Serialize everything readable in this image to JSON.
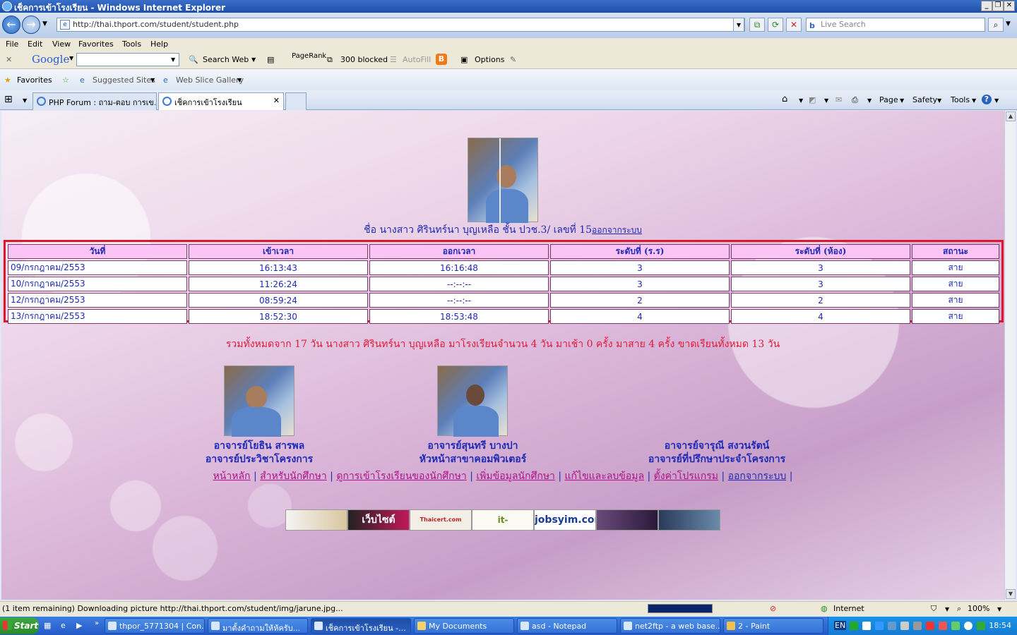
{
  "window": {
    "title": "เช็คการเข้าโรงเรียน - Windows Internet Explorer",
    "url": "http://thai.thport.com/student/student.php",
    "search_placeholder": "Live Search"
  },
  "menu": [
    "File",
    "Edit",
    "View",
    "Favorites",
    "Tools",
    "Help"
  ],
  "google_toolbar": {
    "logo": "Google",
    "search_web": "Search Web",
    "pagerank": "PageRank",
    "blocked": "300 blocked",
    "autofill": "AutoFill",
    "options": "Options"
  },
  "favorites_bar": {
    "favorites": "Favorites",
    "suggested": "Suggested Sites",
    "web_slice": "Web Slice Gallery"
  },
  "tabs": [
    {
      "label": "PHP Forum : ถาม-ตอบ การเข..."
    },
    {
      "label": "เช็คการเข้าโรงเรียน"
    }
  ],
  "command_bar": {
    "page": "Page",
    "safety": "Safety",
    "tools": "Tools"
  },
  "page": {
    "student_line": "ชื่อ นางสาว ศิรินทร์นา บุญเหลือ ชั้น ปวช.3/ เลขที่ 15",
    "logout_inline": "ออกจากระบบ",
    "table": {
      "headers": [
        "วันที่",
        "เข้าเวลา",
        "ออกเวลา",
        "ระดับที่ (ร.ร)",
        "ระดับที่ (ห้อง)",
        "สถานะ"
      ],
      "rows": [
        [
          "09/กรกฎาคม/2553",
          "16:13:43",
          "16:16:48",
          "3",
          "3",
          "สาย"
        ],
        [
          "10/กรกฎาคม/2553",
          "11:26:24",
          "--:--:--",
          "3",
          "3",
          "สาย"
        ],
        [
          "12/กรกฎาคม/2553",
          "08:59:24",
          "--:--:--",
          "2",
          "2",
          "สาย"
        ],
        [
          "13/กรกฎาคม/2553",
          "18:52:30",
          "18:53:48",
          "4",
          "4",
          "สาย"
        ]
      ]
    },
    "summary": "รวมทั้งหมดจาก 17 วัน นางสาว ศิรินทร์นา บุญเหลือ มาโรงเรียนจำนวน 4 วัน มาเช้า 0 ครั้ง มาสาย 4 ครั้ง ขาดเรียนทั้งหมด 13 วัน",
    "teachers": [
      {
        "name": "อาจารย์โยธิน สารพล",
        "role": "อาจารย์ประวิชาโครงการ"
      },
      {
        "name": "อาจารย์สุนทรี บางปา",
        "role": "หัวหน้าสาขาคอมพิวเตอร์"
      },
      {
        "name": "อาจารย์จารุณี สงวนรัตน์",
        "role": "อาจารย์ที่ปรึกษาประจำโครงการ"
      }
    ],
    "nav_links": [
      "หน้าหลัก",
      "สำหรับนักศึกษา",
      "ดูการเข้าโรงเรียนของนักศึกษา",
      "เพิ่มข้อมูลนักศึกษา",
      "แก้ไขและลบข้อมูล",
      "ตั้งค่าโปรแกรม",
      "ออกจากระบบ"
    ],
    "banners": [
      "",
      "เว็บไซต์",
      "Thaicert.com",
      "it-socool.com",
      "jobsyim.com",
      "",
      ""
    ]
  },
  "statusbar": {
    "text": "(1 item remaining) Downloading picture http://thai.thport.com/student/img/jarune.jpg...",
    "progress_fraction": 1.0,
    "zone": "Internet",
    "zoom": "100%"
  },
  "taskbar": {
    "start": "Start",
    "tasks": [
      "thpor_5771304 | Con...",
      "มาตั้งคำถามให้ห้ครับ...",
      "เช็คการเข้าโรงเรียน -...",
      "My Documents",
      "asd - Notepad",
      "net2ftp - a web base...",
      "2 - Paint"
    ],
    "lang": "EN",
    "clock": "18:54"
  }
}
